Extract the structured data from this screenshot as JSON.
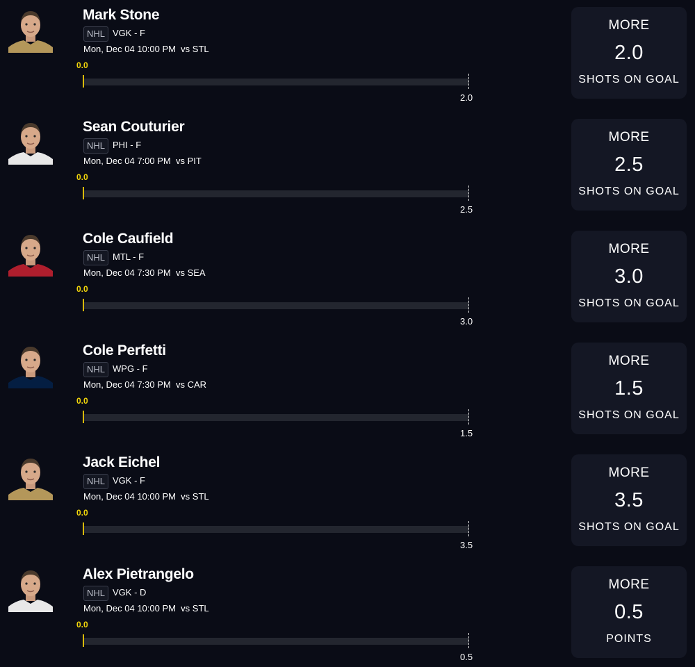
{
  "colors": {
    "background": "#0a0c16",
    "card": "#141724",
    "accent_yellow": "#f5d90a",
    "track": "#23262f"
  },
  "projections": [
    {
      "player": "Mark Stone",
      "avatar_icon": "player-headshot-icon",
      "jersey_color": "#b4975a",
      "league": "NHL",
      "team_pos": "VGK - F",
      "game": "Mon, Dec 04 10:00 PM  vs STL",
      "current": "0.0",
      "progress_fraction": 0,
      "line": "2.0",
      "direction": "MORE",
      "stat": "SHOTS ON GOAL"
    },
    {
      "player": "Sean Couturier",
      "avatar_icon": "player-headshot-icon",
      "jersey_color": "#e8e8e8",
      "league": "NHL",
      "team_pos": "PHI - F",
      "game": "Mon, Dec 04 7:00 PM  vs PIT",
      "current": "0.0",
      "progress_fraction": 0,
      "line": "2.5",
      "direction": "MORE",
      "stat": "SHOTS ON GOAL"
    },
    {
      "player": "Cole Caufield",
      "avatar_icon": "player-headshot-icon",
      "jersey_color": "#af1e2d",
      "league": "NHL",
      "team_pos": "MTL - F",
      "game": "Mon, Dec 04 7:30 PM  vs SEA",
      "current": "0.0",
      "progress_fraction": 0,
      "line": "3.0",
      "direction": "MORE",
      "stat": "SHOTS ON GOAL"
    },
    {
      "player": "Cole Perfetti",
      "avatar_icon": "player-headshot-icon",
      "jersey_color": "#041e42",
      "league": "NHL",
      "team_pos": "WPG - F",
      "game": "Mon, Dec 04 7:30 PM  vs CAR",
      "current": "0.0",
      "progress_fraction": 0,
      "line": "1.5",
      "direction": "MORE",
      "stat": "SHOTS ON GOAL"
    },
    {
      "player": "Jack Eichel",
      "avatar_icon": "player-headshot-icon",
      "jersey_color": "#b4975a",
      "league": "NHL",
      "team_pos": "VGK - F",
      "game": "Mon, Dec 04 10:00 PM  vs STL",
      "current": "0.0",
      "progress_fraction": 0,
      "line": "3.5",
      "direction": "MORE",
      "stat": "SHOTS ON GOAL"
    },
    {
      "player": "Alex Pietrangelo",
      "avatar_icon": "player-headshot-icon",
      "jersey_color": "#e8e8e8",
      "league": "NHL",
      "team_pos": "VGK - D",
      "game": "Mon, Dec 04 10:00 PM  vs STL",
      "current": "0.0",
      "progress_fraction": 0,
      "line": "0.5",
      "direction": "MORE",
      "stat": "POINTS"
    }
  ]
}
